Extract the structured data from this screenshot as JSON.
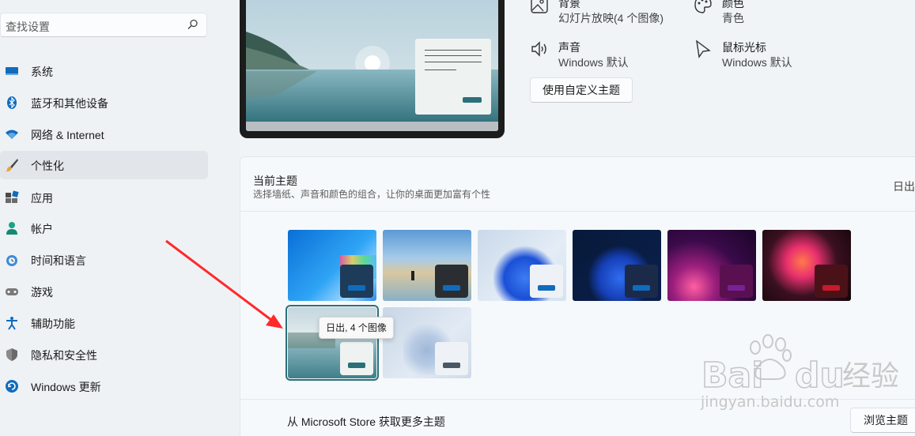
{
  "search": {
    "placeholder": "查找设置"
  },
  "sidebar": {
    "items": [
      {
        "label": "系统",
        "icon": "display-icon"
      },
      {
        "label": "蓝牙和其他设备",
        "icon": "bluetooth-icon"
      },
      {
        "label": "网络 & Internet",
        "icon": "wifi-icon"
      },
      {
        "label": "个性化",
        "icon": "brush-icon",
        "active": true
      },
      {
        "label": "应用",
        "icon": "apps-icon"
      },
      {
        "label": "帐户",
        "icon": "account-icon"
      },
      {
        "label": "时间和语言",
        "icon": "clock-globe-icon"
      },
      {
        "label": "游戏",
        "icon": "gamepad-icon"
      },
      {
        "label": "辅助功能",
        "icon": "accessibility-icon"
      },
      {
        "label": "隐私和安全性",
        "icon": "shield-icon"
      },
      {
        "label": "Windows 更新",
        "icon": "update-icon"
      }
    ]
  },
  "props": {
    "background": {
      "title": "背景",
      "value": "幻灯片放映(4 个图像)"
    },
    "color": {
      "title": "颜色",
      "value": "青色"
    },
    "sound": {
      "title": "声音",
      "value": "Windows 默认"
    },
    "cursor": {
      "title": "鼠标光标",
      "value": "Windows 默认"
    }
  },
  "custom_theme_button": "使用自定义主题",
  "current_theme": {
    "title": "当前主题",
    "subtitle": "选择墙纸、声音和颜色的组合，让你的桌面更加富有个性",
    "selected_name": "日出"
  },
  "tooltip": "日出, 4 个图像",
  "store": {
    "text": "从 Microsoft Store 获取更多主题",
    "button": "浏览主题"
  },
  "watermark": {
    "logo": "Baidu经验",
    "url": "jingyan.baidu.com"
  },
  "colors": {
    "accent": "#2c6f7a",
    "arrow": "#ff2a2a"
  }
}
